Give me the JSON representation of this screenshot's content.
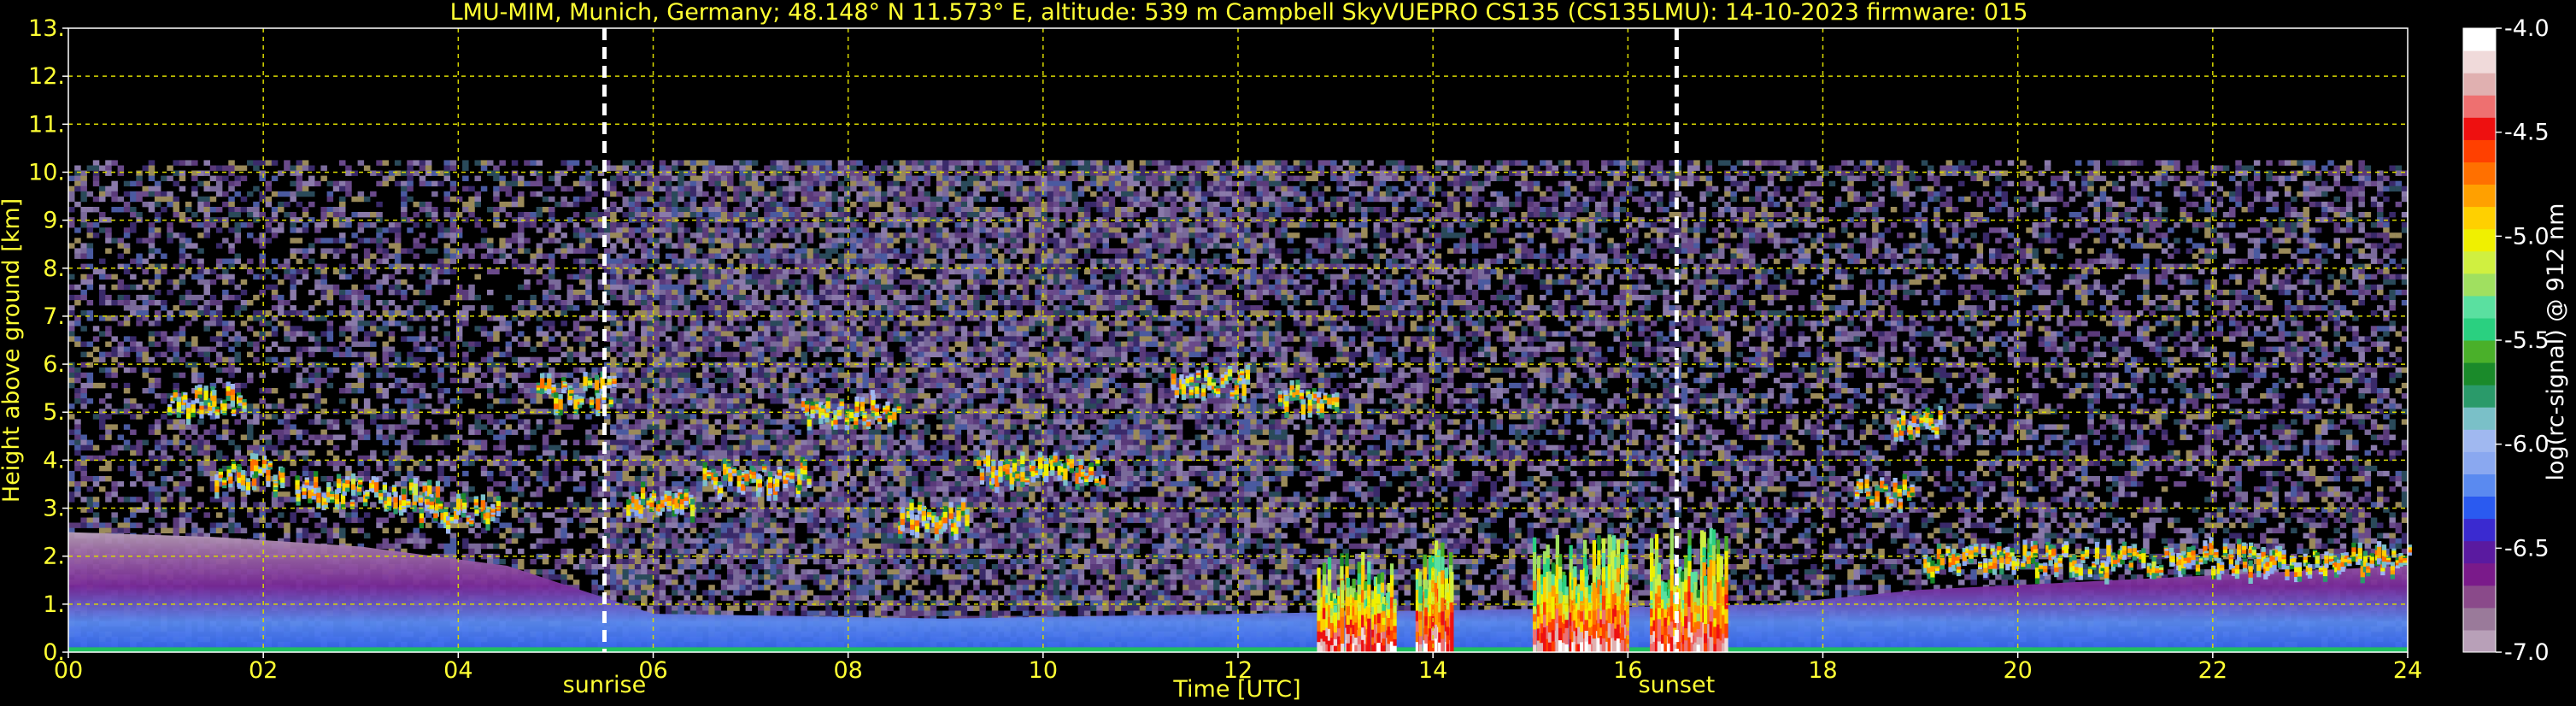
{
  "chart_data": {
    "type": "heatmap",
    "title": "LMU-MIM, Munich, Germany; 48.148° N 11.573° E, altitude: 539 m    Campbell SkyVUEPRO CS135 (CS135LMU): 14-10-2023    firmware: 015",
    "xlabel": "Time [UTC]",
    "ylabel": "Height above ground [km]",
    "xlim": [
      0,
      24
    ],
    "ylim": [
      0,
      13
    ],
    "x_ticks": [
      0,
      2,
      4,
      6,
      8,
      10,
      12,
      14,
      16,
      18,
      20,
      22,
      24
    ],
    "x_tick_labels": [
      "00",
      "02",
      "04",
      "06",
      "08",
      "10",
      "12",
      "14",
      "16",
      "18",
      "20",
      "22",
      "24"
    ],
    "y_ticks": [
      0,
      1,
      2,
      3,
      4,
      5,
      6,
      7,
      8,
      9,
      10,
      11,
      12,
      13
    ],
    "y_tick_labels": [
      "0.",
      "1.",
      "2.",
      "3.",
      "4.",
      "5.",
      "6.",
      "7.",
      "8.",
      "9.",
      "10.",
      "11.",
      "12.",
      "13."
    ],
    "grid": true,
    "max_range_km": 10.25,
    "events": [
      {
        "label": "sunrise",
        "time": 5.5
      },
      {
        "label": "sunset",
        "time": 16.5
      }
    ],
    "colorbar": {
      "label": "log(rc-signal) @ 912 nm",
      "range": [
        -7.0,
        -4.0
      ],
      "ticks": [
        -7.0,
        -6.5,
        -6.0,
        -5.5,
        -5.0,
        -4.5,
        -4.0
      ],
      "tick_labels": [
        "-7.0",
        "-6.5",
        "-6.0",
        "-5.5",
        "-5.0",
        "-4.5",
        "-4.0"
      ],
      "colors": [
        "#b8a0b8",
        "#9a7a9a",
        "#8a4a8a",
        "#7a1a8a",
        "#5a1aa0",
        "#3a2ad0",
        "#2a5af0",
        "#5a8af0",
        "#8aa8f0",
        "#a0b8f0",
        "#7ac0c8",
        "#2a9a6a",
        "#1a8a2a",
        "#4ab02a",
        "#2ad080",
        "#5ae0a0",
        "#a0e060",
        "#d0f040",
        "#f0f000",
        "#ffd000",
        "#ffa000",
        "#ff7000",
        "#ff4000",
        "#ee1010",
        "#ee7070",
        "#e0b0b0",
        "#f0dada",
        "#ffffff"
      ]
    },
    "cloud_layers": [
      {
        "t0": 1.0,
        "t1": 1.8,
        "h": 5.2
      },
      {
        "t0": 1.5,
        "t1": 2.2,
        "h": 3.7
      },
      {
        "t0": 2.3,
        "t1": 3.8,
        "h": 3.3
      },
      {
        "t0": 3.6,
        "t1": 4.4,
        "h": 2.9
      },
      {
        "t0": 4.8,
        "t1": 5.6,
        "h": 5.4
      },
      {
        "t0": 5.7,
        "t1": 6.4,
        "h": 3.1
      },
      {
        "t0": 6.5,
        "t1": 7.6,
        "h": 3.6
      },
      {
        "t0": 7.5,
        "t1": 8.5,
        "h": 5.0
      },
      {
        "t0": 8.5,
        "t1": 9.2,
        "h": 2.8
      },
      {
        "t0": 9.3,
        "t1": 10.6,
        "h": 3.8
      },
      {
        "t0": 11.3,
        "t1": 12.1,
        "h": 5.6
      },
      {
        "t0": 12.4,
        "t1": 13.0,
        "h": 5.3
      },
      {
        "t0": 18.3,
        "t1": 18.9,
        "h": 3.3
      },
      {
        "t0": 18.7,
        "t1": 19.2,
        "h": 4.8
      },
      {
        "t0": 19.0,
        "t1": 24.0,
        "h": 1.9
      }
    ],
    "boundary_layer": [
      {
        "t": 0,
        "h": 2.5
      },
      {
        "t": 1.5,
        "h": 2.4
      },
      {
        "t": 3.0,
        "h": 2.2
      },
      {
        "t": 4.5,
        "h": 1.8
      },
      {
        "t": 6.0,
        "h": 0.8
      },
      {
        "t": 9.0,
        "h": 0.7
      },
      {
        "t": 12.0,
        "h": 0.8
      },
      {
        "t": 15.0,
        "h": 0.9
      },
      {
        "t": 17.5,
        "h": 1.0
      },
      {
        "t": 19.0,
        "h": 1.3
      },
      {
        "t": 21.0,
        "h": 1.5
      },
      {
        "t": 24.0,
        "h": 1.8
      }
    ],
    "precipitation": [
      {
        "t0": 12.8,
        "t1": 13.6,
        "h": 2.2
      },
      {
        "t0": 13.8,
        "t1": 14.2,
        "h": 2.4
      },
      {
        "t0": 15.0,
        "t1": 16.0,
        "h": 2.5
      },
      {
        "t0": 16.2,
        "t1": 17.0,
        "h": 2.6
      }
    ]
  }
}
